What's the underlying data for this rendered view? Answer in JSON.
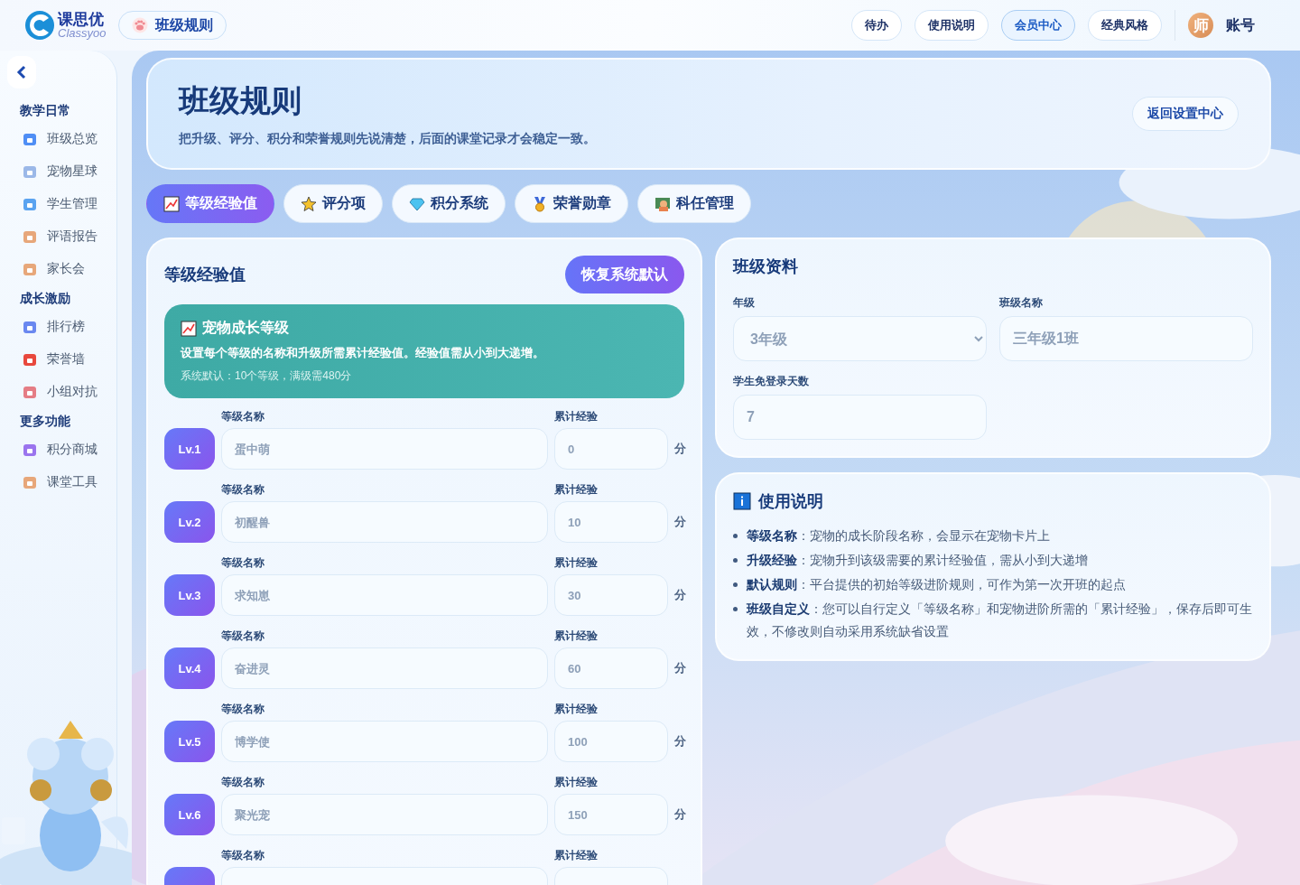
{
  "brand": {
    "name": "课思优",
    "wordmark": "Classyoo"
  },
  "page_chip": {
    "label": "班级规则"
  },
  "top_actions": [
    {
      "label": "待办",
      "selected": false
    },
    {
      "label": "使用说明",
      "selected": false
    },
    {
      "label": "会员中心",
      "selected": true
    },
    {
      "label": "经典风格",
      "selected": false
    }
  ],
  "account": {
    "avatar": "师",
    "label": "账号"
  },
  "sidebar": {
    "sections": [
      {
        "title": "教学日常",
        "items": [
          {
            "label": "班级总览"
          },
          {
            "label": "宠物星球"
          },
          {
            "label": "学生管理"
          },
          {
            "label": "评语报告"
          },
          {
            "label": "家长会"
          }
        ]
      },
      {
        "title": "成长激励",
        "items": [
          {
            "label": "排行榜"
          },
          {
            "label": "荣誉墙"
          },
          {
            "label": "小组对抗"
          }
        ]
      },
      {
        "title": "更多功能",
        "items": [
          {
            "label": "积分商城"
          },
          {
            "label": "课堂工具"
          }
        ]
      }
    ]
  },
  "header": {
    "title": "班级规则",
    "subtitle": "把升级、评分、积分和荣誉规则先说清楚，后面的课堂记录才会稳定一致。",
    "back_button": "返回设置中心"
  },
  "tabs": [
    {
      "label": "等级经验值",
      "selected": true
    },
    {
      "label": "评分项",
      "selected": false
    },
    {
      "label": "积分系统",
      "selected": false
    },
    {
      "label": "荣誉勋章",
      "selected": false
    },
    {
      "label": "科任管理",
      "selected": false
    }
  ],
  "levels_panel": {
    "title": "等级经验值",
    "reset_button": "恢复系统默认",
    "info": {
      "title": "宠物成长等级",
      "text": "设置每个等级的名称和升级所需累计经验值。经验值需从小到大递增。",
      "note": "系统默认：10个等级，满级需480分"
    },
    "rows": [
      {
        "name_label": "等级名称",
        "exp_label": "累计经验",
        "badge": "Lv.1",
        "name_placeholder": "蛋中萌",
        "exp_placeholder": "0",
        "unit": "分"
      },
      {
        "name_label": "等级名称",
        "exp_label": "累计经验",
        "badge": "Lv.2",
        "name_placeholder": "初醒兽",
        "exp_placeholder": "10",
        "unit": "分"
      },
      {
        "name_label": "等级名称",
        "exp_label": "累计经验",
        "badge": "Lv.3",
        "name_placeholder": "求知崽",
        "exp_placeholder": "30",
        "unit": "分"
      },
      {
        "name_label": "等级名称",
        "exp_label": "累计经验",
        "badge": "Lv.4",
        "name_placeholder": "奋进灵",
        "exp_placeholder": "60",
        "unit": "分"
      },
      {
        "name_label": "等级名称",
        "exp_label": "累计经验",
        "badge": "Lv.5",
        "name_placeholder": "博学使",
        "exp_placeholder": "100",
        "unit": "分"
      },
      {
        "name_label": "等级名称",
        "exp_label": "累计经验",
        "badge": "Lv.6",
        "name_placeholder": "聚光宠",
        "exp_placeholder": "150",
        "unit": "分"
      },
      {
        "name_label": "等级名称",
        "exp_label": "累计经验"
      }
    ]
  },
  "class_info": {
    "title": "班级资料",
    "grade": {
      "label": "年级",
      "value": "3年级"
    },
    "class_name": {
      "label": "班级名称",
      "placeholder": "三年级1班"
    },
    "login_days": {
      "label": "学生免登录天数",
      "placeholder": "7"
    }
  },
  "usage": {
    "title": "使用说明",
    "items": [
      "**等级名称**：宠物的成长阶段名称，会显示在宠物卡片上",
      "**升级经验**：宠物升到该级需要的累计经验值，需从小到大递增",
      "**默认规则**：平台提供的初始等级进阶规则，可作为第一次开班的起点",
      "**班级自定义**：您可以自行定义「等级名称」和宠物进阶所需的「累计经验」，保存后即可生效，不修改则自动采用系统缺省设置"
    ]
  }
}
